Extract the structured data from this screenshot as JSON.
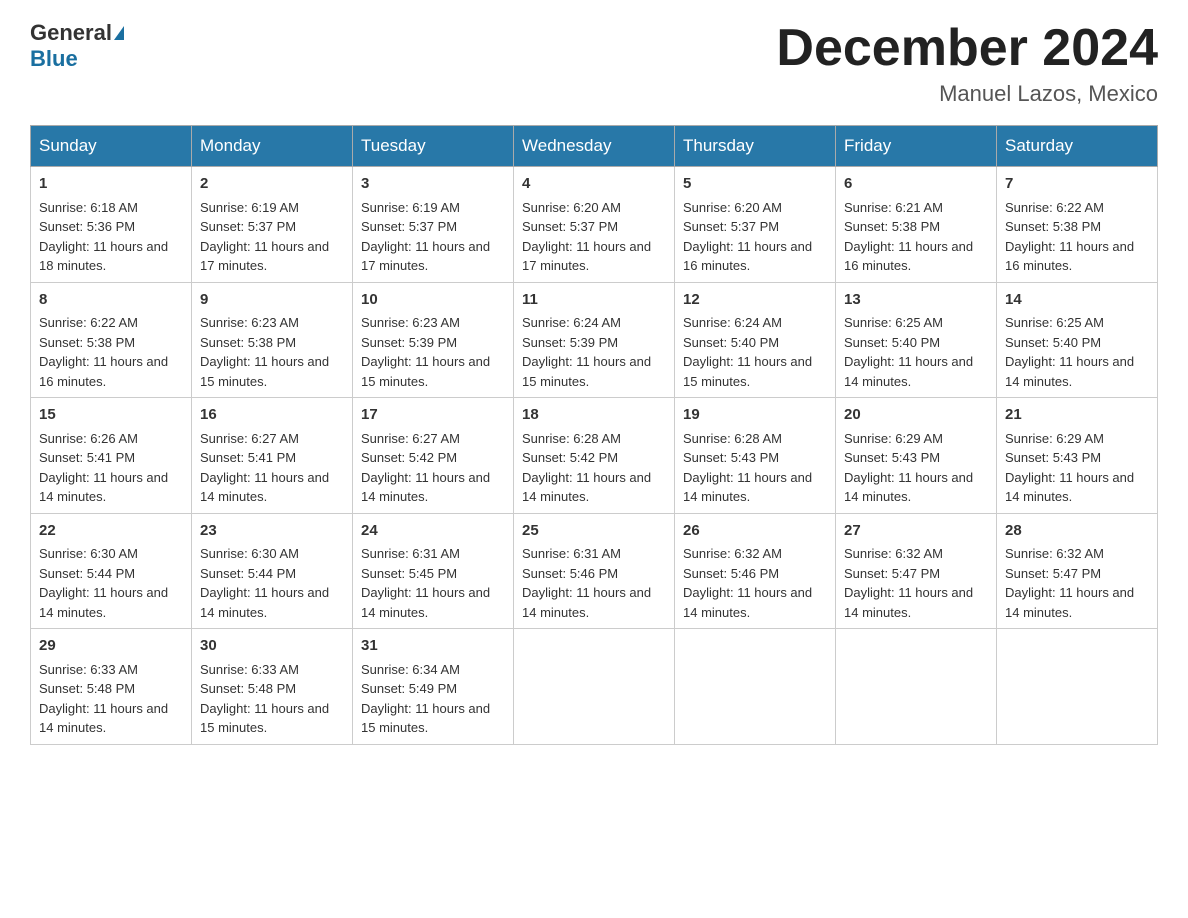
{
  "header": {
    "logo_general": "General",
    "logo_blue": "Blue",
    "month_year": "December 2024",
    "location": "Manuel Lazos, Mexico"
  },
  "days_of_week": [
    "Sunday",
    "Monday",
    "Tuesday",
    "Wednesday",
    "Thursday",
    "Friday",
    "Saturday"
  ],
  "weeks": [
    [
      {
        "day": "1",
        "sunrise": "6:18 AM",
        "sunset": "5:36 PM",
        "daylight": "11 hours and 18 minutes."
      },
      {
        "day": "2",
        "sunrise": "6:19 AM",
        "sunset": "5:37 PM",
        "daylight": "11 hours and 17 minutes."
      },
      {
        "day": "3",
        "sunrise": "6:19 AM",
        "sunset": "5:37 PM",
        "daylight": "11 hours and 17 minutes."
      },
      {
        "day": "4",
        "sunrise": "6:20 AM",
        "sunset": "5:37 PM",
        "daylight": "11 hours and 17 minutes."
      },
      {
        "day": "5",
        "sunrise": "6:20 AM",
        "sunset": "5:37 PM",
        "daylight": "11 hours and 16 minutes."
      },
      {
        "day": "6",
        "sunrise": "6:21 AM",
        "sunset": "5:38 PM",
        "daylight": "11 hours and 16 minutes."
      },
      {
        "day": "7",
        "sunrise": "6:22 AM",
        "sunset": "5:38 PM",
        "daylight": "11 hours and 16 minutes."
      }
    ],
    [
      {
        "day": "8",
        "sunrise": "6:22 AM",
        "sunset": "5:38 PM",
        "daylight": "11 hours and 16 minutes."
      },
      {
        "day": "9",
        "sunrise": "6:23 AM",
        "sunset": "5:38 PM",
        "daylight": "11 hours and 15 minutes."
      },
      {
        "day": "10",
        "sunrise": "6:23 AM",
        "sunset": "5:39 PM",
        "daylight": "11 hours and 15 minutes."
      },
      {
        "day": "11",
        "sunrise": "6:24 AM",
        "sunset": "5:39 PM",
        "daylight": "11 hours and 15 minutes."
      },
      {
        "day": "12",
        "sunrise": "6:24 AM",
        "sunset": "5:40 PM",
        "daylight": "11 hours and 15 minutes."
      },
      {
        "day": "13",
        "sunrise": "6:25 AM",
        "sunset": "5:40 PM",
        "daylight": "11 hours and 14 minutes."
      },
      {
        "day": "14",
        "sunrise": "6:25 AM",
        "sunset": "5:40 PM",
        "daylight": "11 hours and 14 minutes."
      }
    ],
    [
      {
        "day": "15",
        "sunrise": "6:26 AM",
        "sunset": "5:41 PM",
        "daylight": "11 hours and 14 minutes."
      },
      {
        "day": "16",
        "sunrise": "6:27 AM",
        "sunset": "5:41 PM",
        "daylight": "11 hours and 14 minutes."
      },
      {
        "day": "17",
        "sunrise": "6:27 AM",
        "sunset": "5:42 PM",
        "daylight": "11 hours and 14 minutes."
      },
      {
        "day": "18",
        "sunrise": "6:28 AM",
        "sunset": "5:42 PM",
        "daylight": "11 hours and 14 minutes."
      },
      {
        "day": "19",
        "sunrise": "6:28 AM",
        "sunset": "5:43 PM",
        "daylight": "11 hours and 14 minutes."
      },
      {
        "day": "20",
        "sunrise": "6:29 AM",
        "sunset": "5:43 PM",
        "daylight": "11 hours and 14 minutes."
      },
      {
        "day": "21",
        "sunrise": "6:29 AM",
        "sunset": "5:43 PM",
        "daylight": "11 hours and 14 minutes."
      }
    ],
    [
      {
        "day": "22",
        "sunrise": "6:30 AM",
        "sunset": "5:44 PM",
        "daylight": "11 hours and 14 minutes."
      },
      {
        "day": "23",
        "sunrise": "6:30 AM",
        "sunset": "5:44 PM",
        "daylight": "11 hours and 14 minutes."
      },
      {
        "day": "24",
        "sunrise": "6:31 AM",
        "sunset": "5:45 PM",
        "daylight": "11 hours and 14 minutes."
      },
      {
        "day": "25",
        "sunrise": "6:31 AM",
        "sunset": "5:46 PM",
        "daylight": "11 hours and 14 minutes."
      },
      {
        "day": "26",
        "sunrise": "6:32 AM",
        "sunset": "5:46 PM",
        "daylight": "11 hours and 14 minutes."
      },
      {
        "day": "27",
        "sunrise": "6:32 AM",
        "sunset": "5:47 PM",
        "daylight": "11 hours and 14 minutes."
      },
      {
        "day": "28",
        "sunrise": "6:32 AM",
        "sunset": "5:47 PM",
        "daylight": "11 hours and 14 minutes."
      }
    ],
    [
      {
        "day": "29",
        "sunrise": "6:33 AM",
        "sunset": "5:48 PM",
        "daylight": "11 hours and 14 minutes."
      },
      {
        "day": "30",
        "sunrise": "6:33 AM",
        "sunset": "5:48 PM",
        "daylight": "11 hours and 15 minutes."
      },
      {
        "day": "31",
        "sunrise": "6:34 AM",
        "sunset": "5:49 PM",
        "daylight": "11 hours and 15 minutes."
      },
      null,
      null,
      null,
      null
    ]
  ],
  "labels": {
    "sunrise": "Sunrise:",
    "sunset": "Sunset:",
    "daylight": "Daylight:"
  }
}
